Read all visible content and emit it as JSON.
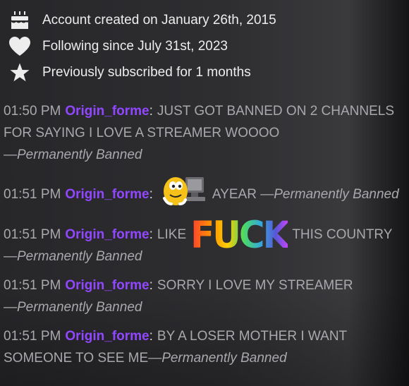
{
  "info": {
    "account_created": "Account created on January 26th, 2015",
    "following_since": "Following since July 31st, 2023",
    "subscribed": "Previously subscribed for 1 months",
    "icons": [
      "cake-icon",
      "heart-icon",
      "star-icon"
    ]
  },
  "chat": {
    "username_color": "#9147ff",
    "messages": [
      {
        "time": "01:50 PM",
        "user": "Origin_forme",
        "text": "JUST GOT BANNED ON 2 CHANNELS FOR SAYING I LOVE A STREAMER WOOOO",
        "status": "—Permanently Banned"
      },
      {
        "time": "01:51 PM",
        "user": "Origin_forme",
        "emote": "mm-candy-computer-emote",
        "text": "AYEAR",
        "status": "—Permanently Banned"
      },
      {
        "time": "01:51 PM",
        "user": "Origin_forme",
        "text_before": "LIKE",
        "emote_word": "FUCK",
        "text_after": "THIS COUNTRY",
        "status": "—Permanently Banned"
      },
      {
        "time": "01:51 PM",
        "user": "Origin_forme",
        "text": "SORRY I LOVE MY STREAMER",
        "status": "—Permanently Banned"
      },
      {
        "time": "01:51 PM",
        "user": "Origin_forme",
        "text": "BY A LOSER MOTHER I WANT SOMEONE TO SEE ME",
        "status": "—Permanently Banned"
      }
    ]
  }
}
